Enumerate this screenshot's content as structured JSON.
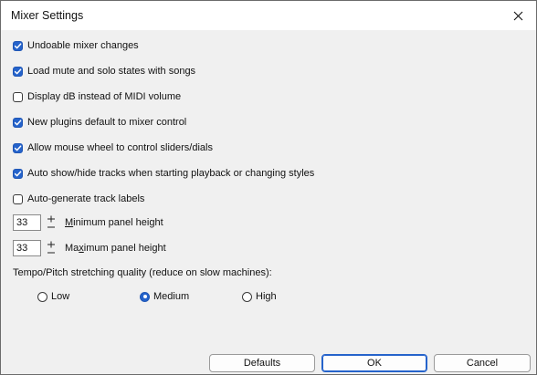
{
  "window": {
    "title": "Mixer Settings",
    "close_icon": "close-icon"
  },
  "options": [
    {
      "label": "Undoable mixer changes",
      "checked": true
    },
    {
      "label": "Load mute and solo states with songs",
      "checked": true
    },
    {
      "label": "Display dB instead of MIDI volume",
      "checked": false
    },
    {
      "label": "New plugins default to mixer control",
      "checked": true
    },
    {
      "label": "Allow mouse wheel to control sliders/dials",
      "checked": true
    },
    {
      "label": "Auto show/hide tracks when starting playback or changing styles",
      "checked": true
    },
    {
      "label": "Auto-generate track labels",
      "checked": false
    }
  ],
  "min_panel": {
    "value": "33",
    "label_pre": "",
    "label_u": "M",
    "label_post": "inimum panel height"
  },
  "max_panel": {
    "value": "33",
    "label_pre": "Ma",
    "label_u": "x",
    "label_post": "imum panel height"
  },
  "stretch": {
    "label": "Tempo/Pitch stretching quality (reduce on slow machines):",
    "options": [
      "Low",
      "Medium",
      "High"
    ],
    "selected": "Medium"
  },
  "footer": {
    "defaults_label": "Defaults",
    "ok_label": "OK",
    "cancel_label": "Cancel"
  },
  "colors": {
    "accent": "#2563cb",
    "panel_bg": "#f0f0f0",
    "title_bg": "#ffffff"
  }
}
